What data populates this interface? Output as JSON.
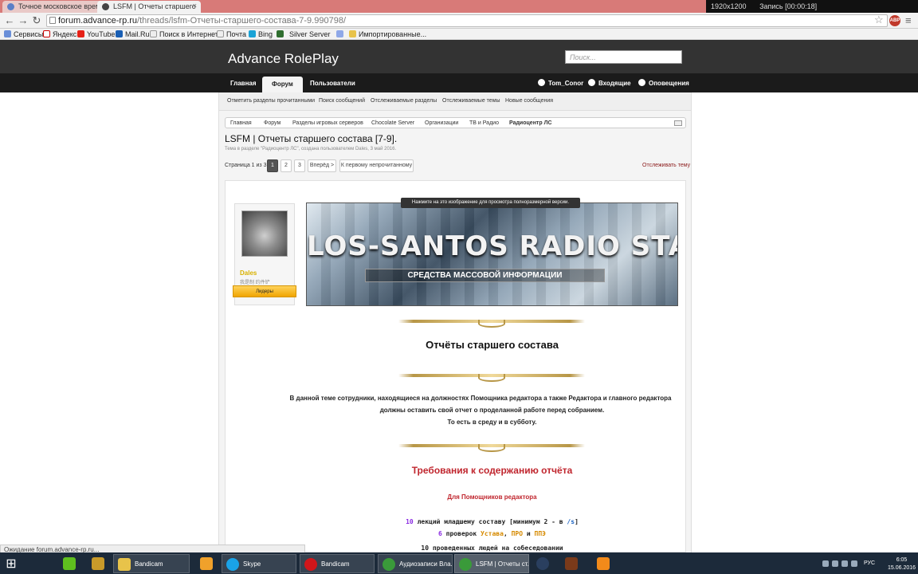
{
  "browser": {
    "tabs": [
      {
        "title": "Точное московское врем"
      },
      {
        "title": "LSFM | Отчеты старшего"
      }
    ],
    "recorder": {
      "resolution": "1920x1200",
      "status": "Запись [00:00:18]"
    },
    "url_host": "forum.advance-rp.ru",
    "url_path": "/threads/lsfm-Отчеты-старшего-состава-7-9.990798/",
    "bookmarks": [
      "Сервисы",
      "Яндекс",
      "YouTube",
      "Mail.Ru",
      "Поиск в Интернете",
      "Почта",
      "Bing",
      "Silver Server",
      "Импортированные..."
    ],
    "extension_badge": "ABP",
    "status_text": "Ожидание forum.advance-rp.ru..."
  },
  "site": {
    "title": "Advance RolePlay",
    "search_placeholder": "Поиск...",
    "nav": {
      "home": "Главная",
      "forum": "Форум",
      "users": "Пользователи"
    },
    "user": {
      "name": "Tom_Conor",
      "inbox": "Входящие",
      "alerts": "Оповещения"
    },
    "subnav": [
      "Отметить разделы прочитанными",
      "Поиск сообщений",
      "Отслеживаемые разделы",
      "Отслеживаемые темы",
      "Новые сообщения"
    ],
    "breadcrumbs": [
      "Главная",
      "Форум",
      "Разделы игровых серверов",
      "Chocolate Server",
      "Организации",
      "ТВ и Радио",
      "Радиоцентр ЛС"
    ]
  },
  "thread": {
    "title": "LSFM | Отчеты старшего состава [7-9].",
    "meta": "Тема в разделе \"Радиоцентр ЛС\", создана пользователем Dales, 3 май 2016.",
    "page_label": "Страница 1 из 3",
    "pages": [
      "1",
      "2",
      "3"
    ],
    "next": "Вперёд >",
    "first_unread": "К первому непрочитанному",
    "watch": "Отслеживать тему"
  },
  "post": {
    "author": {
      "name": "Dales",
      "title": "我是制 约件铲",
      "banner": "Лидеры"
    },
    "image_tooltip": "Нажмите на это изображение для просмотра полноразмерной версии.",
    "banner_title": "LOS-SANTOS RADIO STATION",
    "banner_subtitle": "СРЕДСТВА МАССОВОЙ ИНФОРМАЦИИ",
    "heading": "Отчёты старшего состава",
    "body_line1": "В данной теме сотрудники, находящиеся на должностях Помощника редактора а также Редактора и главного редактора",
    "body_line2": "должны оставить свой отчет о проделанной работе перед собранием.",
    "body_line3": "То есть в среду и в субботу.",
    "req_title": "Требования к содержанию отчёта",
    "req_sub": "Для Помощников редактора",
    "item1": {
      "num": "10",
      "text": "лекций младшему составу [минимум 2 - в",
      "link": "/s",
      "close": "]"
    },
    "item2": {
      "num": "6",
      "pre": "проверок",
      "a": "Устава",
      "sep": ",",
      "b": "ПРО",
      "and": "и",
      "c": "ППЭ"
    },
    "item3": "10 проведенных людей на собеседовании"
  },
  "taskbar": {
    "apps": [
      "Bandicam",
      "Skype",
      "Bandicam",
      "Аудиозаписи Вла...",
      "LSFM | Отчеты ст..."
    ],
    "lang": "РУС",
    "time": "6:05",
    "date": "15.06.2016"
  }
}
